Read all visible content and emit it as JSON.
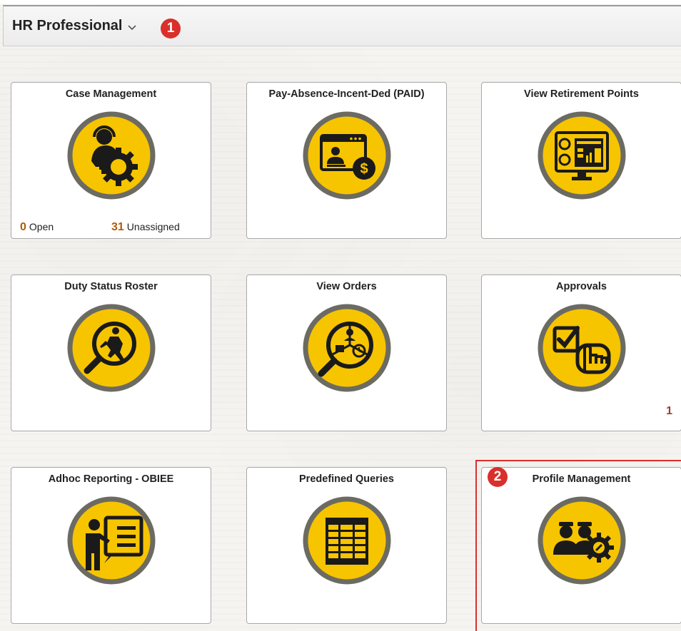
{
  "header": {
    "title": "HR Professional"
  },
  "callouts": [
    "1",
    "2"
  ],
  "tiles": [
    {
      "title": "Case Management",
      "icon": "case-management-icon",
      "open_count": "0",
      "open_label": "Open",
      "unassigned_count": "31",
      "unassigned_label": "Unassigned"
    },
    {
      "title": "Pay-Absence-Incent-Ded (PAID)",
      "icon": "pay-dollar-icon"
    },
    {
      "title": "View Retirement Points",
      "icon": "retirement-monitor-icon"
    },
    {
      "title": "Duty Status Roster",
      "icon": "soldier-magnifier-icon"
    },
    {
      "title": "View Orders",
      "icon": "orders-magnifier-icon"
    },
    {
      "title": "Approvals",
      "icon": "checkbox-hand-icon",
      "badge": "1"
    },
    {
      "title": "Adhoc Reporting - OBIEE",
      "icon": "presenter-icon"
    },
    {
      "title": "Predefined Queries",
      "icon": "table-grid-icon"
    },
    {
      "title": "Profile Management",
      "icon": "users-gear-icon"
    }
  ],
  "colors": {
    "icon_fill": "#f7c400",
    "icon_ring": "#6b6b63",
    "icon_glyph": "#1a1a1a",
    "callout": "#d9302b"
  }
}
